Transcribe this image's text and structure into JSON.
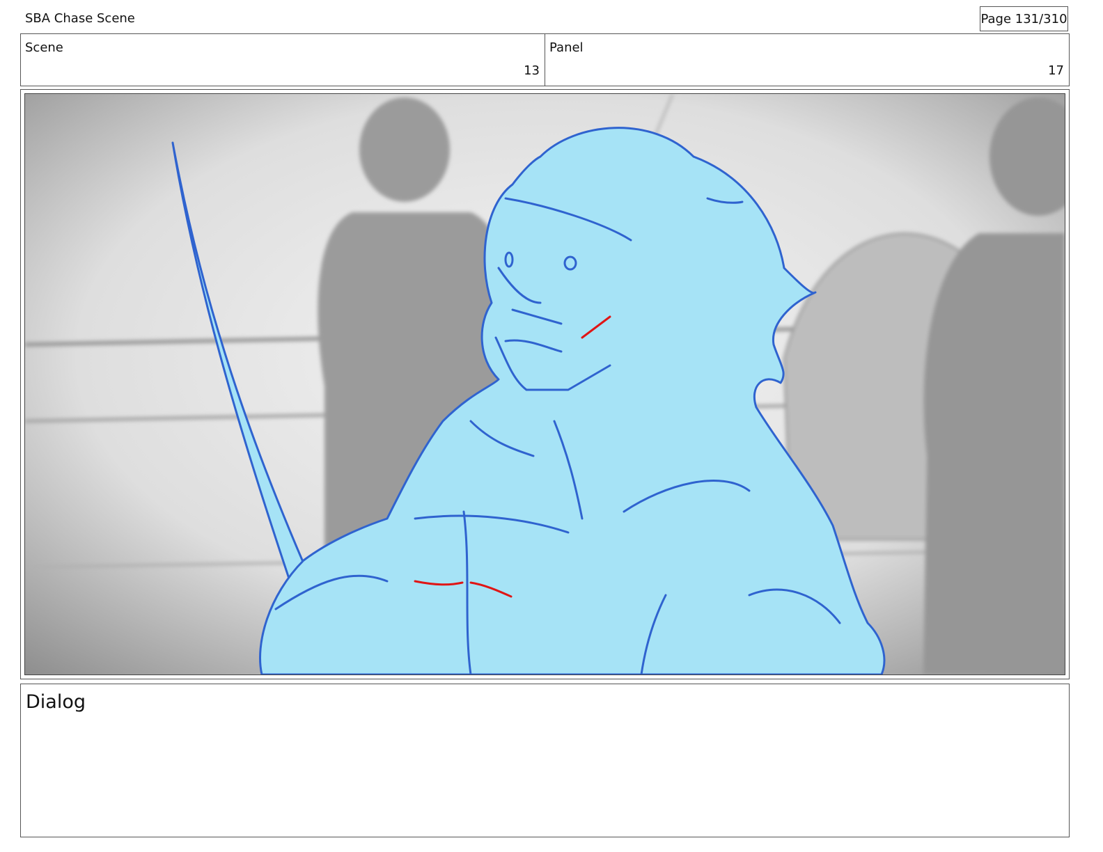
{
  "header": {
    "title": "SBA Chase Scene",
    "page": "Page 131/310"
  },
  "meta": {
    "scene_label": "Scene",
    "scene_value": "13",
    "panel_label": "Panel",
    "panel_value": "17"
  },
  "panel": {
    "image": "storyboard-sketch"
  },
  "dialog": {
    "label": "Dialog"
  }
}
